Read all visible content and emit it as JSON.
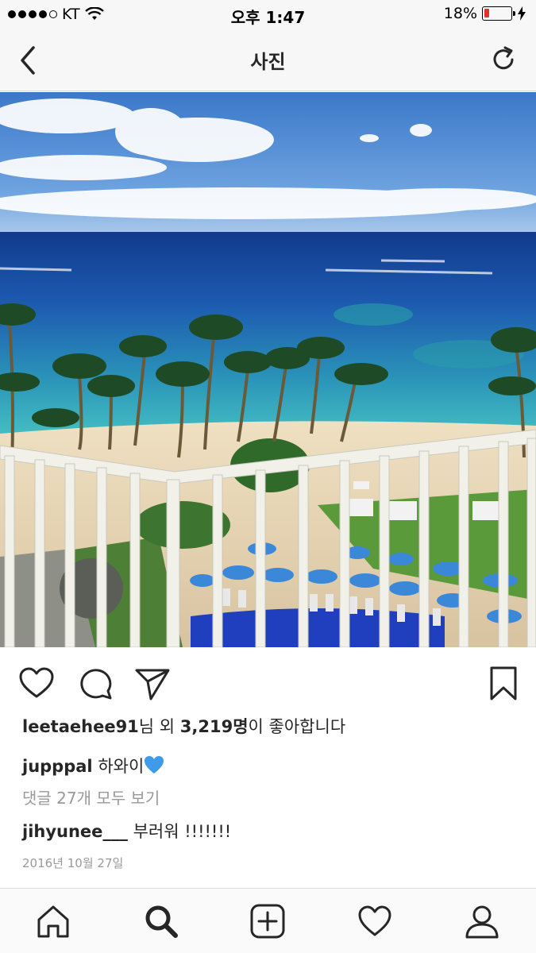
{
  "status_bar": {
    "carrier": "KT",
    "time": "오후 1:47",
    "battery_percent_label": "18%",
    "battery_level": 0.18,
    "signal_bars_filled": 4
  },
  "nav": {
    "title": "사진"
  },
  "post": {
    "likes": {
      "first_user": "leetaehee91",
      "mid_text": "님 외 ",
      "count": "3,219명",
      "suffix": "이 좋아합니다"
    },
    "caption": {
      "user": "jupppal",
      "text": "하와이"
    },
    "view_comments_label": "댓글 27개 모두 보기",
    "comment": {
      "user": "jihyunee___",
      "text": "부러워 !!!!!!!"
    },
    "date": "2016년 10월 27일"
  },
  "colors": {
    "battery_low": "#e0342a",
    "muted_text": "#999999",
    "heart_emoji": "#3d9be9"
  },
  "icons": {
    "back": "chevron-left-icon",
    "refresh": "refresh-icon",
    "like": "heart-outline-icon",
    "comment": "comment-bubble-icon",
    "share": "paper-plane-icon",
    "save": "bookmark-icon",
    "tab_home": "home-icon",
    "tab_search": "search-icon",
    "tab_add": "add-post-icon",
    "tab_activity": "heart-icon",
    "tab_profile": "profile-icon"
  }
}
